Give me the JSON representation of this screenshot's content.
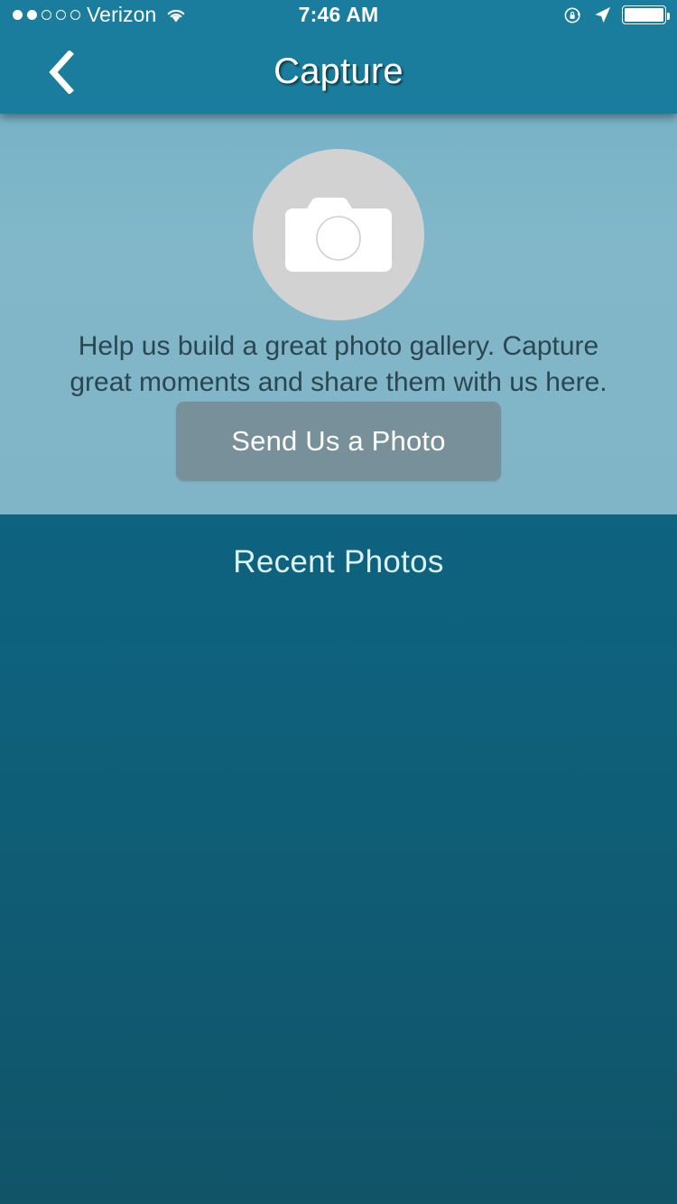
{
  "status_bar": {
    "carrier": "Verizon",
    "signal_dots_filled": 2,
    "signal_dots_total": 5,
    "wifi_icon": "wifi-icon",
    "time": "7:46 AM",
    "rotation_lock_icon": "rotation-lock-icon",
    "location_icon": "location-arrow-icon",
    "battery_icon": "battery-full-icon",
    "background_color": "#1a7d9e",
    "text_color": "#ffffff"
  },
  "nav_bar": {
    "back_icon": "chevron-left-icon",
    "title": "Capture",
    "background_color": "#1a7d9e",
    "title_color": "#ffffff"
  },
  "promo": {
    "camera_icon": "camera-icon",
    "badge_color": "#d2d2d2",
    "message": "Help us build a great photo gallery. Capture great moments and share them with us here.",
    "message_color": "#2b4650",
    "panel_color": "#7fb5c7",
    "button": {
      "label": "Send Us a Photo",
      "background_color": "#77909a",
      "text_color": "#ffffff"
    }
  },
  "gallery": {
    "heading": "Recent Photos",
    "heading_color": "#dcf2f7",
    "background_color": "#0e6380",
    "photos": []
  }
}
